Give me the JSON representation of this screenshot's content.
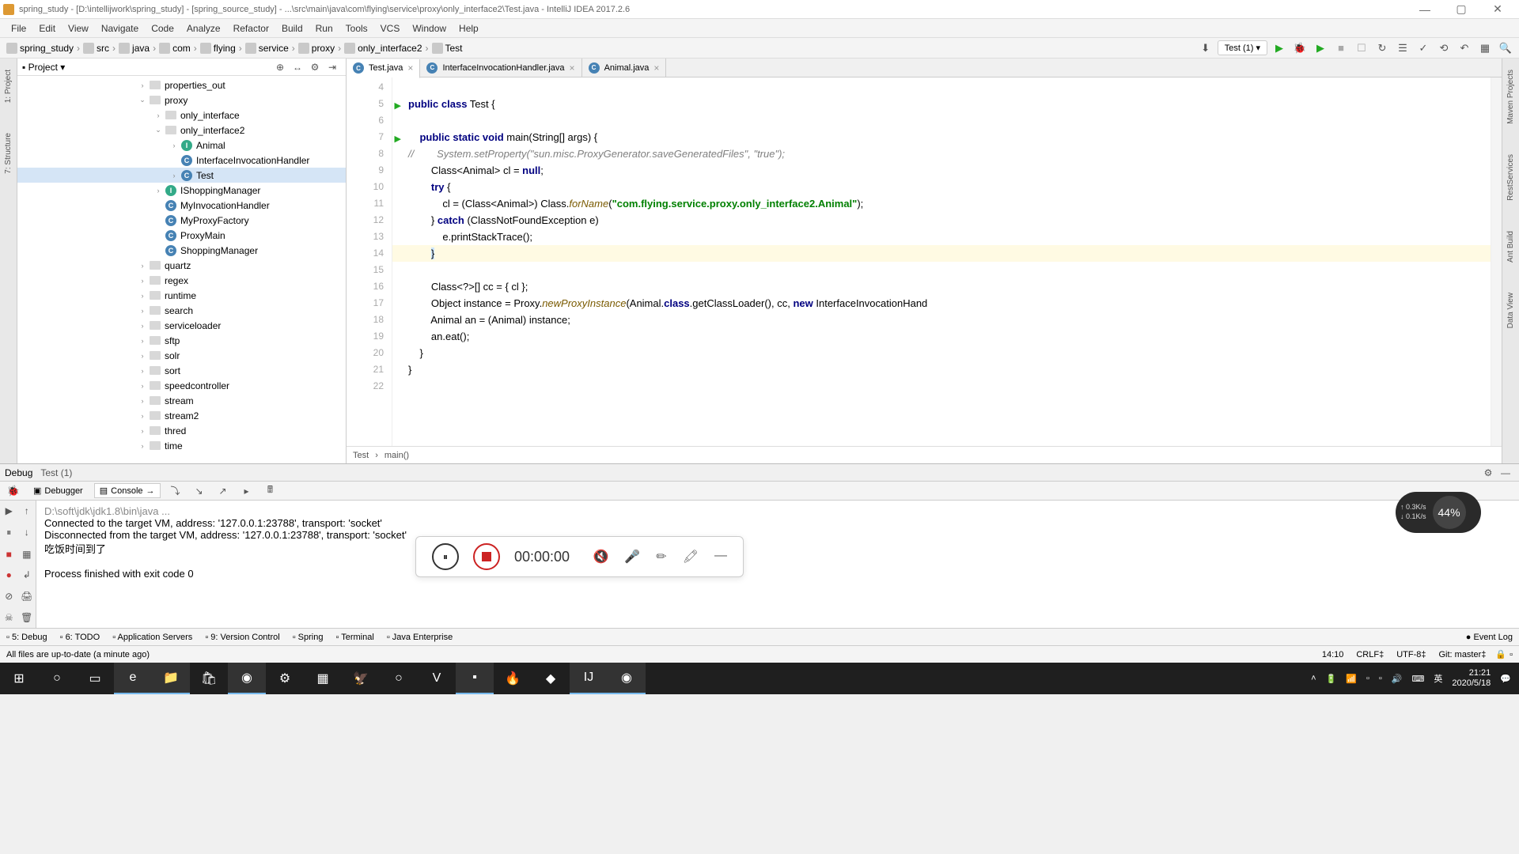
{
  "title": "spring_study - [D:\\intellijwork\\spring_study] - [spring_source_study] - ...\\src\\main\\java\\com\\flying\\service\\proxy\\only_interface2\\Test.java - IntelliJ IDEA 2017.2.6",
  "menus": [
    "File",
    "Edit",
    "View",
    "Navigate",
    "Code",
    "Analyze",
    "Refactor",
    "Build",
    "Run",
    "Tools",
    "VCS",
    "Window",
    "Help"
  ],
  "breadcrumb": [
    "spring_study",
    "src",
    "java",
    "com",
    "flying",
    "service",
    "proxy",
    "only_interface2",
    "Test"
  ],
  "run_config": "Test (1)",
  "sidebar_left": [
    "1: Project",
    "7: Structure"
  ],
  "sidebar_right": [
    "Maven Projects",
    "RestServices",
    "Ant Build",
    "Data View"
  ],
  "proj_header": "Project",
  "tree": [
    {
      "pad": 150,
      "caret": "›",
      "type": "folder",
      "label": "properties_out"
    },
    {
      "pad": 150,
      "caret": "⌄",
      "type": "folder",
      "label": "proxy"
    },
    {
      "pad": 170,
      "caret": "›",
      "type": "folder",
      "label": "only_interface"
    },
    {
      "pad": 170,
      "caret": "⌄",
      "type": "folder",
      "label": "only_interface2"
    },
    {
      "pad": 190,
      "caret": "›",
      "type": "interface",
      "label": "Animal"
    },
    {
      "pad": 190,
      "caret": "",
      "type": "class",
      "label": "InterfaceInvocationHandler"
    },
    {
      "pad": 190,
      "caret": "›",
      "type": "class",
      "label": "Test",
      "selected": true
    },
    {
      "pad": 170,
      "caret": "›",
      "type": "interface",
      "label": "IShoppingManager"
    },
    {
      "pad": 170,
      "caret": "",
      "type": "class",
      "label": "MyInvocationHandler"
    },
    {
      "pad": 170,
      "caret": "",
      "type": "class",
      "label": "MyProxyFactory"
    },
    {
      "pad": 170,
      "caret": "",
      "type": "class",
      "label": "ProxyMain"
    },
    {
      "pad": 170,
      "caret": "",
      "type": "class",
      "label": "ShoppingManager"
    },
    {
      "pad": 150,
      "caret": "›",
      "type": "folder",
      "label": "quartz"
    },
    {
      "pad": 150,
      "caret": "›",
      "type": "folder",
      "label": "regex"
    },
    {
      "pad": 150,
      "caret": "›",
      "type": "folder",
      "label": "runtime"
    },
    {
      "pad": 150,
      "caret": "›",
      "type": "folder",
      "label": "search"
    },
    {
      "pad": 150,
      "caret": "›",
      "type": "folder",
      "label": "serviceloader"
    },
    {
      "pad": 150,
      "caret": "›",
      "type": "folder",
      "label": "sftp"
    },
    {
      "pad": 150,
      "caret": "›",
      "type": "folder",
      "label": "solr"
    },
    {
      "pad": 150,
      "caret": "›",
      "type": "folder",
      "label": "sort"
    },
    {
      "pad": 150,
      "caret": "›",
      "type": "folder",
      "label": "speedcontroller"
    },
    {
      "pad": 150,
      "caret": "›",
      "type": "folder",
      "label": "stream"
    },
    {
      "pad": 150,
      "caret": "›",
      "type": "folder",
      "label": "stream2"
    },
    {
      "pad": 150,
      "caret": "›",
      "type": "folder",
      "label": "thred"
    },
    {
      "pad": 150,
      "caret": "›",
      "type": "folder",
      "label": "time"
    }
  ],
  "editor_tabs": [
    {
      "label": "Test.java",
      "active": true
    },
    {
      "label": "InterfaceInvocationHandler.java",
      "active": false
    },
    {
      "label": "Animal.java",
      "active": false
    }
  ],
  "gutter_start": 4,
  "gutter_end": 22,
  "code": {
    "l5a": "public class",
    "l5b": " Test {",
    "l7a": "public static void",
    "l7b": " main(String[] args) {",
    "l8": "//        System.setProperty(\"sun.misc.ProxyGenerator.saveGeneratedFiles\", \"true\");",
    "l9a": "Class<Animal> cl = ",
    "l9b": "null",
    "l9c": ";",
    "l10a": "try",
    "l10b": " {",
    "l11a": "cl = (Class<Animal>) Class.",
    "l11b": "forName",
    "l11c": "(",
    "l11d": "\"com.flying.service.proxy.only_interface2.Animal\"",
    "l11e": ");",
    "l12a": "} ",
    "l12b": "catch",
    "l12c": " (ClassNotFoundException e) ",
    "l12d": "{",
    "l13": "e.printStackTrace();",
    "l14": "}",
    "l16": "Class<?>[] cc = { cl };",
    "l17a": "Object instance = Proxy.",
    "l17b": "newProxyInstance",
    "l17c": "(Animal.",
    "l17d": "class",
    "l17e": ".getClassLoader(), cc, ",
    "l17f": "new",
    "l17g": " InterfaceInvocationHand",
    "l18": "Animal an = (Animal) instance;",
    "l19": "an.eat();",
    "l20": "}",
    "l21": "}"
  },
  "bottom_bread": [
    "Test",
    "main()"
  ],
  "debug_title": "Debug",
  "debug_run": "Test (1)",
  "debugger_tab": "Debugger",
  "console_tab": "Console",
  "console_lines": [
    {
      "text": "D:\\soft\\jdk\\jdk1.8\\bin\\java ...",
      "class": "cmt2"
    },
    {
      "text": "Connected to the target VM, address: '127.0.0.1:23788', transport: 'socket'"
    },
    {
      "text": "Disconnected from the target VM, address: '127.0.0.1:23788', transport: 'socket'"
    },
    {
      "text": "吃饭时间到了"
    },
    {
      "text": ""
    },
    {
      "text": "Process finished with exit code 0"
    }
  ],
  "recorder_time": "00:00:00",
  "meter": {
    "up": "↑ 0.3K/s",
    "down": "↓ 0.1K/s",
    "pct": "44%"
  },
  "bottom_items": [
    "5: Debug",
    "6: TODO",
    "Application Servers",
    "9: Version Control",
    "Spring",
    "Terminal",
    "Java Enterprise"
  ],
  "event_log": "Event Log",
  "status_msg": "All files are up-to-date (a minute ago)",
  "status_right": [
    "14:10",
    "CRLF‡",
    "UTF-8‡",
    "Git: master‡"
  ],
  "clock_time": "21:21",
  "clock_date": "2020/5/18",
  "ime": "英"
}
